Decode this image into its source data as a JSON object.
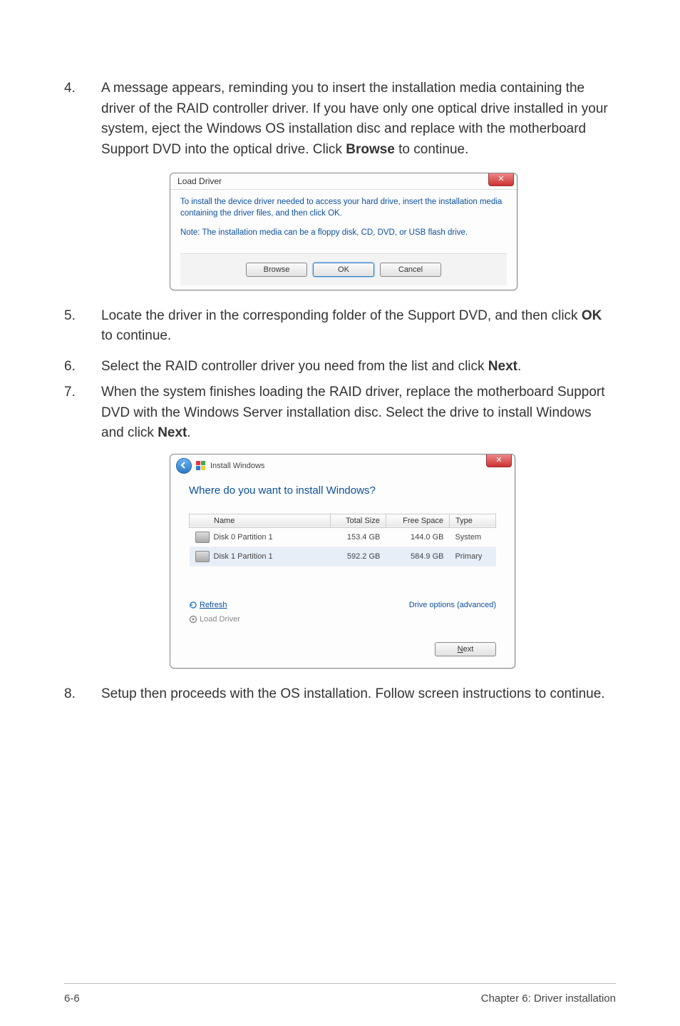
{
  "steps": {
    "s4": {
      "num": "4.",
      "text_a": "A message appears, reminding you to insert the installation media containing the driver of the RAID controller driver. If you have only one optical drive installed in your system, eject the Windows OS installation disc and replace with the motherboard Support DVD into the optical drive. Click ",
      "bold": "Browse",
      "text_b": " to continue."
    },
    "s5": {
      "num": "5.",
      "text_a": "Locate the driver in the corresponding folder of the Support DVD, and then click ",
      "bold": "OK",
      "text_b": " to continue."
    },
    "s6": {
      "num": "6.",
      "text_a": "Select the RAID controller driver you need from the list and click ",
      "bold": "Next",
      "text_b": "."
    },
    "s7": {
      "num": "7.",
      "text_a": "When the system finishes loading the RAID driver, replace the motherboard Support DVD with the Windows Server installation disc. Select the drive to install Windows and click ",
      "bold": "Next",
      "text_b": "."
    },
    "s8": {
      "num": "8.",
      "text_a": "Setup then proceeds with the OS installation. Follow screen instructions to continue."
    }
  },
  "dialog1": {
    "title": "Load Driver",
    "msg1": "To install the device driver needed to access your hard drive, insert the installation media containing the driver files, and then click OK.",
    "msg2": "Note: The installation media can be a floppy disk, CD, DVD, or USB flash drive.",
    "browse": "Browse",
    "ok": "OK",
    "cancel": "Cancel"
  },
  "dialog2": {
    "header": "Install Windows",
    "question": "Where do you want to install Windows?",
    "cols": {
      "name": "Name",
      "total": "Total Size",
      "free": "Free Space",
      "type": "Type"
    },
    "rows": [
      {
        "name": "Disk 0 Partition 1",
        "total": "153.4 GB",
        "free": "144.0 GB",
        "type": "System",
        "selected": false
      },
      {
        "name": "Disk 1 Partition 1",
        "total": "592.2 GB",
        "free": "584.9 GB",
        "type": "Primary",
        "selected": true
      }
    ],
    "refresh": "Refresh",
    "drive_options": "Drive options (advanced)",
    "load_driver": "Load Driver",
    "next": "Next"
  },
  "footer": {
    "page": "6-6",
    "chapter": "Chapter 6: Driver installation"
  }
}
